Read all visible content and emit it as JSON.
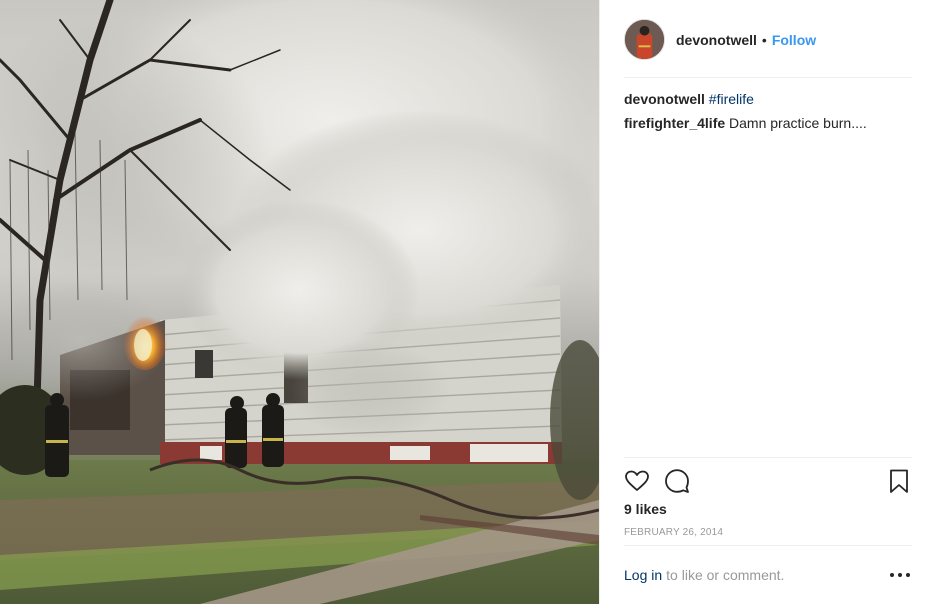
{
  "post": {
    "author": "devonotwell",
    "separator": "•",
    "follow_label": "Follow",
    "comments": [
      {
        "user": "devonotwell",
        "hashtag": "#firelife",
        "text": ""
      },
      {
        "user": "firefighter_4life",
        "hashtag": "",
        "text": "Damn practice burn...."
      }
    ],
    "likes": "9 likes",
    "date": "FEBRUARY 26, 2014",
    "footer": {
      "login_label": "Log in",
      "rest_label": "to like or comment."
    }
  },
  "icons": {
    "like": "heart-icon",
    "comment": "speech-bubble-icon",
    "save": "bookmark-icon",
    "more": "more-options-icon"
  },
  "colors": {
    "link": "#3897f0",
    "hashtag": "#003569",
    "muted": "#999999",
    "text": "#262626"
  }
}
